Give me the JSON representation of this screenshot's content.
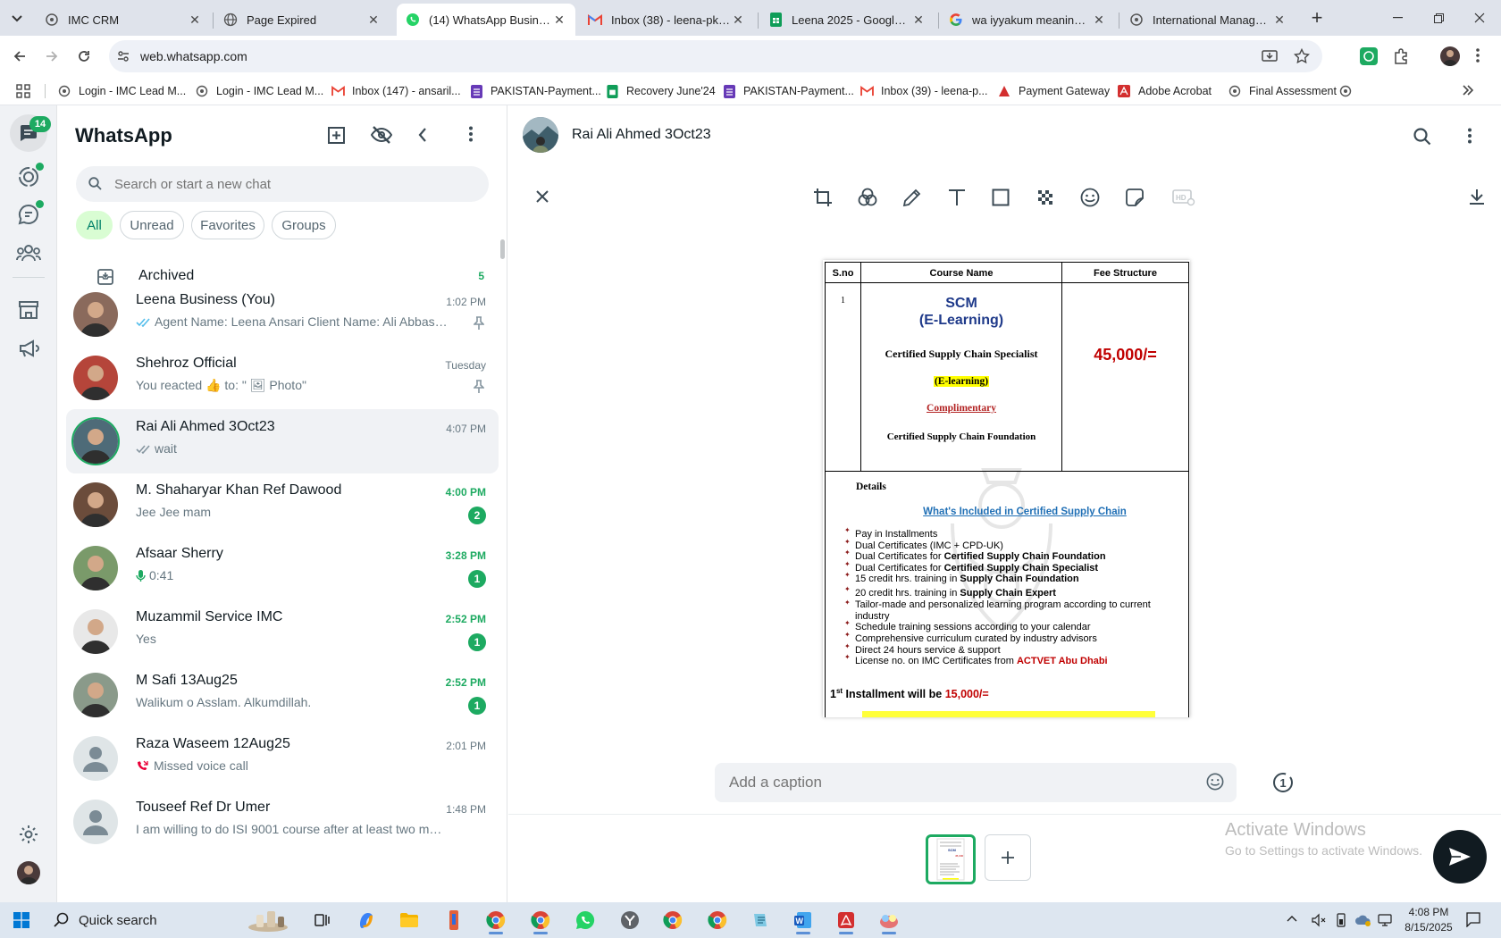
{
  "browser": {
    "tabs": [
      {
        "title": "IMC CRM",
        "icon": "imc-logo-icon",
        "active": false
      },
      {
        "title": "Page Expired",
        "icon": "globe-icon",
        "active": false
      },
      {
        "title": "(14) WhatsApp Business",
        "icon": "whatsapp-icon",
        "active": true
      },
      {
        "title": "Inbox (38) - leena-pk@im",
        "icon": "gmail-icon",
        "active": false
      },
      {
        "title": "Leena 2025 - Google She",
        "icon": "sheets-icon",
        "active": false
      },
      {
        "title": "wa iyyakum meaning in u",
        "icon": "google-icon",
        "active": false
      },
      {
        "title": "International Manageme",
        "icon": "imc-logo-icon",
        "active": false
      }
    ],
    "url": "web.whatsapp.com",
    "bookmarks": [
      {
        "label": "Login - IMC Lead M...",
        "icon": "imc-logo-icon"
      },
      {
        "label": "Login - IMC Lead M...",
        "icon": "imc-logo-icon"
      },
      {
        "label": "Inbox (147) - ansaril...",
        "icon": "gmail-icon"
      },
      {
        "label": "PAKISTAN-Payment...",
        "icon": "forms-icon"
      },
      {
        "label": "Recovery June'24",
        "icon": "sheets-icon"
      },
      {
        "label": "PAKISTAN-Payment...",
        "icon": "forms-icon"
      },
      {
        "label": "Inbox (39) - leena-p...",
        "icon": "gmail-icon"
      },
      {
        "label": "Payment Gateway",
        "icon": "payment-icon"
      },
      {
        "label": "Adobe Acrobat",
        "icon": "acrobat-icon"
      },
      {
        "label": "Final Assessment",
        "icon": "imc-logo-icon"
      }
    ]
  },
  "rail": {
    "chats_badge": "14"
  },
  "sidebar": {
    "title": "WhatsApp",
    "search_placeholder": "Search or start a new chat",
    "filters": [
      "All",
      "Unread",
      "Favorites",
      "Groups"
    ],
    "archived": {
      "label": "Archived",
      "count": "5"
    },
    "chats": [
      {
        "name": "Leena Business (You)",
        "time": "1:02 PM",
        "message": "Agent Name: Leena Ansari  Client Name: Ali Abbas ...",
        "ticks": true,
        "pinned": true,
        "unread": "",
        "avatar": "#8a6a5c"
      },
      {
        "name": "Shehroz Official",
        "time": "Tuesday",
        "message": "You reacted 👍 to: \" 🖼 Photo\"",
        "ticks": false,
        "pinned": true,
        "unread": "",
        "avatar": "#b5453a"
      },
      {
        "name": "Rai Ali Ahmed 3Oct23",
        "time": "4:07 PM",
        "message": "wait",
        "ticks": true,
        "pinned": false,
        "unread": "",
        "avatar": "#4e6b78",
        "selected": true
      },
      {
        "name": "M. Shaharyar Khan Ref Dawood",
        "time": "4:00 PM",
        "message": "Jee Jee mam",
        "ticks": false,
        "pinned": false,
        "unread": "2",
        "avatar": "#6b4c3b"
      },
      {
        "name": "Afsaar Sherry",
        "time": "3:28 PM",
        "message": "0:41",
        "mic": true,
        "ticks": false,
        "pinned": false,
        "unread": "1",
        "avatar": "#7a9a6a"
      },
      {
        "name": "Muzammil Service IMC",
        "time": "2:52 PM",
        "message": "Yes",
        "ticks": false,
        "pinned": false,
        "unread": "1",
        "avatar": "#e8e8e8"
      },
      {
        "name": "M Safi 13Aug25",
        "time": "2:52 PM",
        "message": "Walikum o Asslam. Alkumdillah.",
        "ticks": false,
        "pinned": false,
        "unread": "1",
        "avatar": "#8a9a8a"
      },
      {
        "name": "Raza Waseem 12Aug25",
        "time": "2:01 PM",
        "message": "Missed voice call",
        "missed": true,
        "ticks": false,
        "pinned": false,
        "unread": "",
        "avatar": "#dfe5e7"
      },
      {
        "name": "Touseef Ref Dr Umer",
        "time": "1:48 PM",
        "message": "I am willing to do ISI 9001 course after at least two months...",
        "ticks": false,
        "pinned": false,
        "unread": "",
        "avatar": "#dfe5e7"
      }
    ]
  },
  "conversation": {
    "contact_name": "Rai Ali Ahmed 3Oct23",
    "caption_placeholder": "Add a caption",
    "view_once": "1",
    "watermark_title": "Activate Windows",
    "watermark_sub": "Go to Settings to activate Windows."
  },
  "document": {
    "headers": [
      "S.no",
      "Course Name",
      "Fee Structure"
    ],
    "sno": "1",
    "course_code": "SCM",
    "course_mode": "(E-Learning)",
    "course_title": "Certified Supply Chain Specialist",
    "highlight": "(E-learning)",
    "complimentary": "Complimentary",
    "foundation": "Certified Supply Chain Foundation",
    "fee": "45,000/=",
    "details_label": "Details",
    "included_title": "What's Included in Certified Supply Chain",
    "bullets": [
      {
        "text": "Pay in Installments",
        "bold": ""
      },
      {
        "text": "Dual Certificates (IMC + CPD-UK)",
        "bold": ""
      },
      {
        "text": "Dual Certificates for ",
        "bold": "Certified Supply Chain Foundation"
      },
      {
        "text": "Dual Certificates for ",
        "bold": "Certified Supply Chain Specialist"
      },
      {
        "text": "15 credit hrs. training in ",
        "bold": "Supply Chain Foundation"
      },
      {
        "text": "20 credit hrs. training in ",
        "bold": "Supply Chain Expert"
      },
      {
        "text": "Tailor-made and personalized learning program according to current industry",
        "bold": ""
      },
      {
        "text": "Schedule training sessions according to your calendar",
        "bold": ""
      },
      {
        "text": "Comprehensive curriculum curated by industry advisors",
        "bold": ""
      },
      {
        "text": "Direct 24 hours service & support",
        "bold": ""
      },
      {
        "text": "License no. on IMC Certificates from ",
        "bold": "ACTVET Abu Dhabi"
      }
    ],
    "installment_prefix": "1",
    "installment_sup": "st",
    "installment_text": " Installment will be ",
    "installment_amount": "15,000/="
  },
  "taskbar": {
    "search_label": "Quick search",
    "time": "4:08 PM",
    "date": "8/15/2025"
  },
  "colors": {
    "accent": "#1daa61",
    "teal": "#008069",
    "fee_red": "#c00000",
    "link_blue": "#1f4e9a"
  }
}
